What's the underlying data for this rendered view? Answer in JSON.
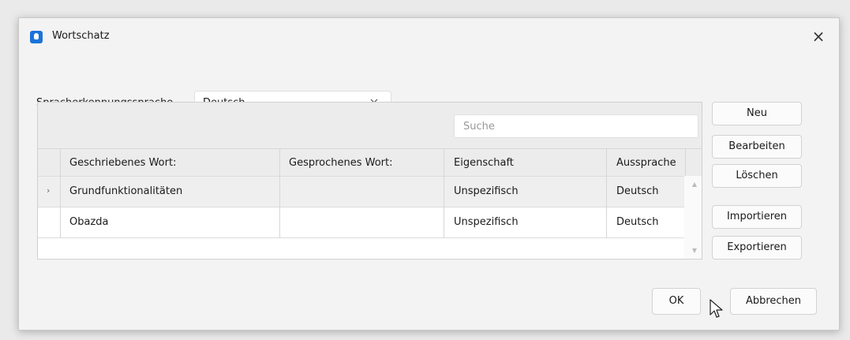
{
  "window": {
    "title": "Wortschatz",
    "close_glyph": "×"
  },
  "language": {
    "label": "Spracherkennungssprache",
    "selected": "Deutsch"
  },
  "search": {
    "placeholder": "Suche"
  },
  "table": {
    "columns": [
      "Geschriebenes Wort:",
      "Gesprochenes Wort:",
      "Eigenschaft",
      "Aussprache"
    ],
    "rows": [
      {
        "marker": "›",
        "written": "Grundfunktionalitäten",
        "spoken": "",
        "property": "Unspezifisch",
        "pronunciation": "Deutsch"
      },
      {
        "marker": "",
        "written": "Obazda",
        "spoken": "",
        "property": "Unspezifisch",
        "pronunciation": "Deutsch"
      }
    ]
  },
  "side_buttons": {
    "new": "Neu",
    "edit": "Bearbeiten",
    "delete": "Löschen",
    "import": "Importieren",
    "export": "Exportieren"
  },
  "footer": {
    "ok": "OK",
    "cancel": "Abbrechen"
  },
  "colors": {
    "accent": "#1a6fc5",
    "icon": "#1a73d9"
  }
}
